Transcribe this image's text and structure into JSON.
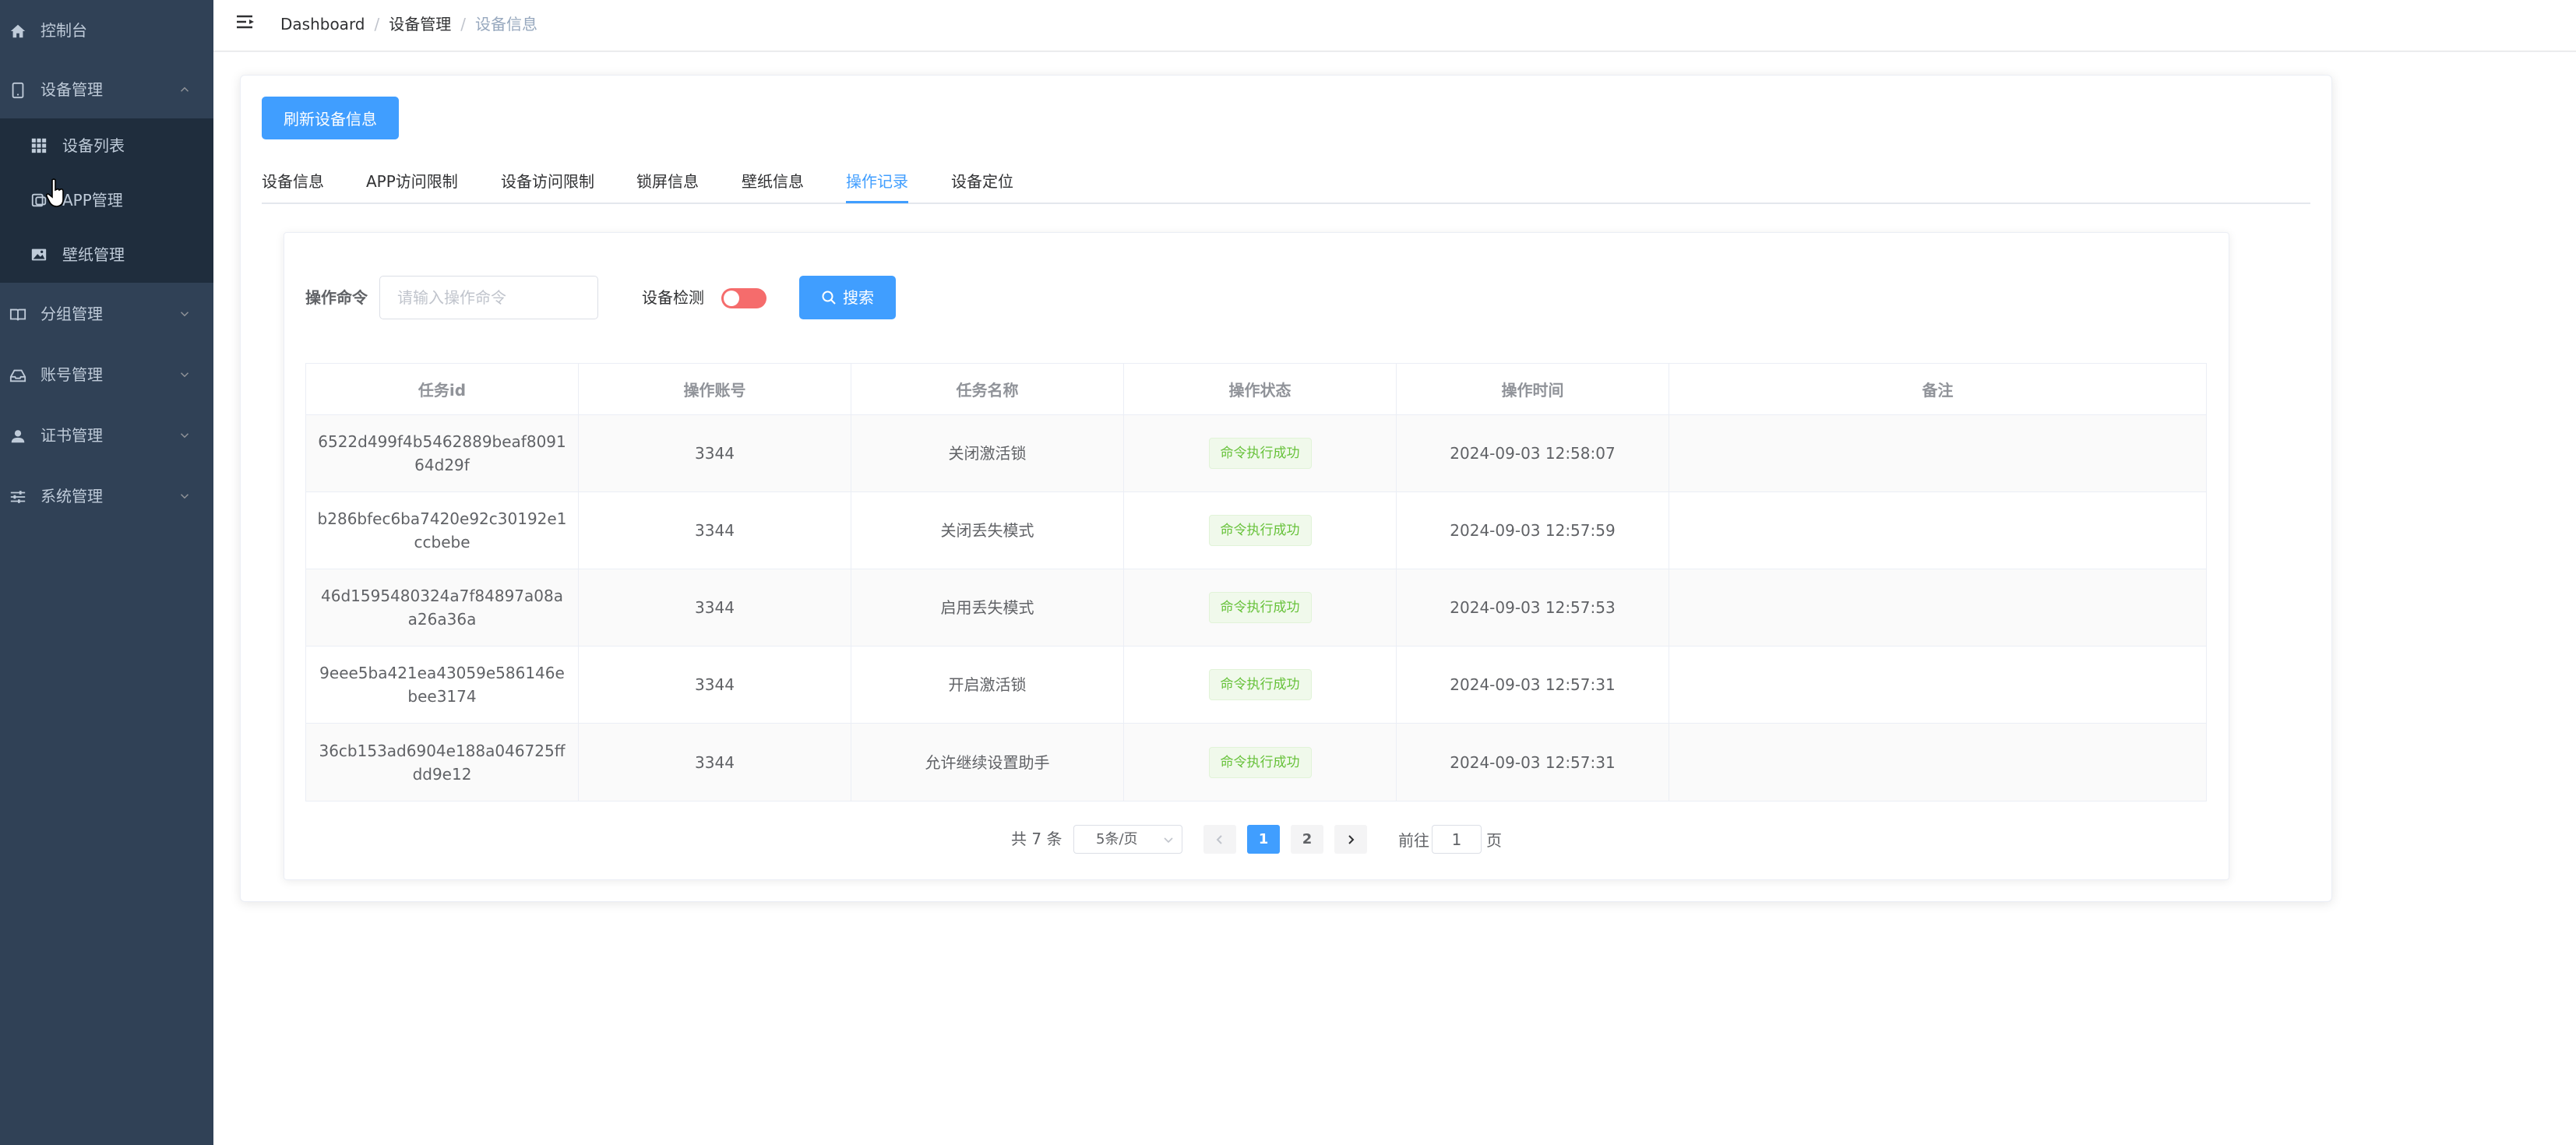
{
  "colors": {
    "sidebar_bg": "#304156",
    "submenu_bg": "#1f2d3d",
    "accent": "#409eff",
    "success": "#67c23a",
    "switch_off": "#f56c6c"
  },
  "sidebar": {
    "items": [
      {
        "label": "控制台",
        "icon": "home-icon"
      },
      {
        "label": "设备管理",
        "icon": "tablet-icon",
        "expanded": true,
        "children": [
          {
            "label": "设备列表",
            "icon": "grid-icon"
          },
          {
            "label": "APP管理",
            "icon": "app-icon"
          },
          {
            "label": "壁纸管理",
            "icon": "image-icon"
          }
        ]
      },
      {
        "label": "分组管理",
        "icon": "book-icon"
      },
      {
        "label": "账号管理",
        "icon": "account-icon"
      },
      {
        "label": "证书管理",
        "icon": "person-icon"
      },
      {
        "label": "系统管理",
        "icon": "sliders-icon"
      }
    ]
  },
  "header": {
    "breadcrumb": [
      "Dashboard",
      "设备管理",
      "设备信息"
    ]
  },
  "main": {
    "refresh_label": "刷新设备信息",
    "tabs": [
      {
        "label": "设备信息"
      },
      {
        "label": "APP访问限制"
      },
      {
        "label": "设备访问限制"
      },
      {
        "label": "锁屏信息"
      },
      {
        "label": "壁纸信息"
      },
      {
        "label": "操作记录",
        "active": true
      },
      {
        "label": "设备定位"
      }
    ],
    "filter": {
      "command_label": "操作命令",
      "command_placeholder": "请输入操作命令",
      "command_value": "",
      "detect_label": "设备检测",
      "detect_on": false,
      "search_label": "搜索"
    },
    "table": {
      "columns": [
        "任务id",
        "操作账号",
        "任务名称",
        "操作状态",
        "操作时间",
        "备注"
      ],
      "rows": [
        {
          "id": "6522d499f4b5462889beaf809164d29f",
          "account": "3344",
          "task": "关闭激活锁",
          "status": "命令执行成功",
          "time": "2024-09-03 12:58:07",
          "note": ""
        },
        {
          "id": "b286bfec6ba7420e92c30192e1ccbebe",
          "account": "3344",
          "task": "关闭丢失模式",
          "status": "命令执行成功",
          "time": "2024-09-03 12:57:59",
          "note": ""
        },
        {
          "id": "46d1595480324a7f84897a08aa26a36a",
          "account": "3344",
          "task": "启用丢失模式",
          "status": "命令执行成功",
          "time": "2024-09-03 12:57:53",
          "note": ""
        },
        {
          "id": "9eee5ba421ea43059e586146ebee3174",
          "account": "3344",
          "task": "开启激活锁",
          "status": "命令执行成功",
          "time": "2024-09-03 12:57:31",
          "note": ""
        },
        {
          "id": "36cb153ad6904e188a046725ffdd9e12",
          "account": "3344",
          "task": "允许继续设置助手",
          "status": "命令执行成功",
          "time": "2024-09-03 12:57:31",
          "note": ""
        }
      ]
    },
    "pagination": {
      "total_text": "共 7 条",
      "page_size": "5条/页",
      "pages": [
        "1",
        "2"
      ],
      "current_page": "1",
      "goto_label": "前往",
      "goto_value": "1",
      "page_suffix": "页"
    }
  }
}
